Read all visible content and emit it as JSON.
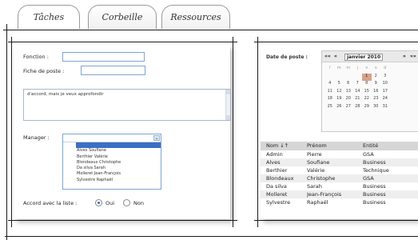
{
  "tabs": [
    {
      "label": "Tâches",
      "active": true
    },
    {
      "label": "Corbeille",
      "active": false
    },
    {
      "label": "Ressources",
      "active": false
    }
  ],
  "form": {
    "fonction_label": "Fonction :",
    "fonction_value": "",
    "fiche_label": "Fiche de poste :",
    "fiche_value": "",
    "comment_text": "d'accord, mais je veux approfondir",
    "manager_label": "Manager :",
    "manager_selected": "",
    "manager_options": [
      "",
      "Alves Soufiane",
      "Berthier Valérie",
      "Blondeaux Christophe",
      "Da silva Sarah",
      "Molleret Jean-François",
      "Sylvestre Raphaël"
    ],
    "accord_label": "Accord avec la liste :",
    "accord_options": [
      {
        "label": "Oui",
        "checked": true
      },
      {
        "label": "Non",
        "checked": false
      }
    ]
  },
  "calendar": {
    "date_label": "Date de poste :",
    "nav_prev_prev": "««",
    "nav_prev": "«",
    "month_label": "janvier 2010",
    "nav_next": "»",
    "nav_next_next": "»»",
    "weekdays": [
      "l",
      "m",
      "m",
      "j",
      "v",
      "s",
      "d"
    ],
    "weeks": [
      [
        "",
        "",
        "",
        "",
        "1",
        "2",
        "3"
      ],
      [
        "4",
        "5",
        "6",
        "7",
        "8",
        "9",
        "10"
      ],
      [
        "11",
        "12",
        "13",
        "14",
        "15",
        "16",
        "17"
      ],
      [
        "18",
        "19",
        "20",
        "21",
        "22",
        "23",
        "24"
      ],
      [
        "25",
        "26",
        "27",
        "28",
        "29",
        "30",
        "31"
      ]
    ],
    "selected_day": "1"
  },
  "table": {
    "headers": [
      "Nom ↓↑",
      "Prénom",
      "Entité"
    ],
    "rows": [
      [
        "Admin",
        "Pierre",
        "GSA"
      ],
      [
        "Alves",
        "Soufiane",
        "Business"
      ],
      [
        "Berthier",
        "Valérie",
        "Technique"
      ],
      [
        "Blondeaux",
        "Christophe",
        "GSA"
      ],
      [
        "Da silva",
        "Sarah",
        "Business"
      ],
      [
        "Molleret",
        "Jean-François",
        "Business"
      ],
      [
        "Sylvestre",
        "Raphaël",
        "Business"
      ]
    ]
  }
}
